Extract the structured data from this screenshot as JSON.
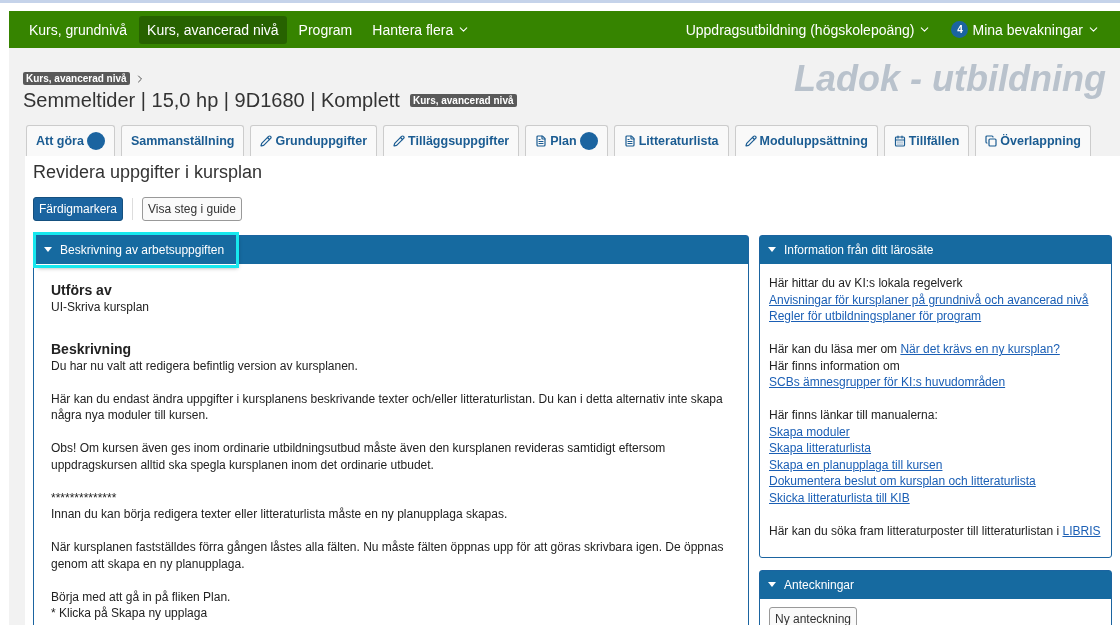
{
  "nav": {
    "items": [
      {
        "label": "Kurs, grundnivå",
        "selected": false,
        "dropdown": false
      },
      {
        "label": "Kurs, avancerad nivå",
        "selected": true,
        "dropdown": false
      },
      {
        "label": "Program",
        "selected": false,
        "dropdown": false
      },
      {
        "label": "Hantera flera",
        "selected": false,
        "dropdown": true
      }
    ],
    "right": [
      {
        "label": "Uppdragsutbildning (högskolepoäng)"
      },
      {
        "label": "Mina bevakningar",
        "count": "4"
      }
    ]
  },
  "brand": "Ladok - utbildning",
  "breadcrumb": "Kurs, avancerad nivå",
  "heading": {
    "title": "Semmeltider | 15,0 hp | 9D1680 | Komplett",
    "tag": "Kurs, avancerad nivå"
  },
  "tabs": [
    {
      "label": "Att göra",
      "dot": true
    },
    {
      "label": "Sammanställning",
      "dot": false
    },
    {
      "label": "Grunduppgifter",
      "dot": false
    },
    {
      "label": "Tilläggsuppgifter",
      "dot": false
    },
    {
      "label": "Plan",
      "dot": true
    },
    {
      "label": "Litteraturlista",
      "dot": false
    },
    {
      "label": "Moduluppsättning",
      "dot": false
    },
    {
      "label": "Tillfällen",
      "dot": false
    },
    {
      "label": "Överlappning",
      "dot": false
    }
  ],
  "page_title": "Revidera uppgifter i kursplan",
  "buttons": [
    {
      "label": "Färdigmarkera",
      "kind": "primary"
    },
    {
      "label": "Visa steg i guide",
      "kind": "default"
    }
  ],
  "task_panel": {
    "title": "Beskrivning av arbetsuppgiften",
    "expanded": true,
    "focused": true,
    "sections": [
      {
        "heading": "Utförs av",
        "paragraphs": [
          [
            "UI-Skriva kursplan"
          ]
        ]
      },
      {
        "heading": "Beskrivning",
        "paragraphs": [
          [
            "Du har nu valt att redigera befintlig version av kursplanen."
          ],
          [
            "Här kan du endast ändra uppgifter i kursplanens beskrivande texter och/eller litteraturlistan. Du kan i detta alternativ inte skapa några nya moduler till kursen."
          ],
          [
            "Obs! Om kursen även ges inom ordinarie utbildningsutbud måste även den kursplanen revideras samtidigt eftersom uppdragskursen alltid ska spegla kursplanen inom det ordinarie utbudet."
          ],
          [
            "**************",
            "Innan du kan börja redigera texter eller litteraturlista måste en ny planupplaga skapas."
          ],
          [
            "När kursplanen fastställdes förra gången låstes alla fälten. Nu måste fälten öppnas upp för att göras skrivbara igen. De öppnas genom att skapa en ny planupplaga."
          ],
          [
            "Börja med att gå in på fliken Plan.",
            "* Klicka på Skapa ny upplaga"
          ]
        ]
      }
    ]
  },
  "info_panel": {
    "title": "Information från ditt lärosäte",
    "expanded": true,
    "groups": [
      [
        [
          {
            "kind": "text",
            "text": "Här hittar du av KI:s lokala regelverk"
          }
        ],
        [
          {
            "kind": "link",
            "text": "Anvisningar för kursplaner på grundnivå och avancerad nivå"
          }
        ],
        [
          {
            "kind": "link",
            "text": "Regler för utbildningsplaner för program"
          }
        ]
      ],
      [
        [
          {
            "kind": "text",
            "text": "Här kan du läsa mer om "
          },
          {
            "kind": "link",
            "text": "När det krävs en ny kursplan?"
          }
        ],
        [
          {
            "kind": "text",
            "text": "Här finns information om "
          },
          {
            "kind": "link",
            "text": "SCBs ämnesgrupper för KI:s huvudområden"
          }
        ]
      ],
      [
        [
          {
            "kind": "text",
            "text": "Här finns länkar till manualerna:"
          }
        ],
        [
          {
            "kind": "link",
            "text": "Skapa moduler"
          }
        ],
        [
          {
            "kind": "link",
            "text": "Skapa litteraturlista"
          }
        ],
        [
          {
            "kind": "link",
            "text": "Skapa en planupplaga till kursen"
          }
        ],
        [
          {
            "kind": "link",
            "text": "Dokumentera beslut om kursplan och litteraturlista"
          }
        ],
        [
          {
            "kind": "link",
            "text": "Skicka litteraturlista till KIB"
          }
        ]
      ],
      [
        [
          {
            "kind": "text",
            "text": "Här kan du söka fram litteraturposter till litteraturlistan i "
          },
          {
            "kind": "link",
            "text": "LIBRIS"
          }
        ]
      ]
    ]
  },
  "notes_panel": {
    "title": "Anteckningar",
    "expanded": true,
    "button": "Ny anteckning"
  }
}
